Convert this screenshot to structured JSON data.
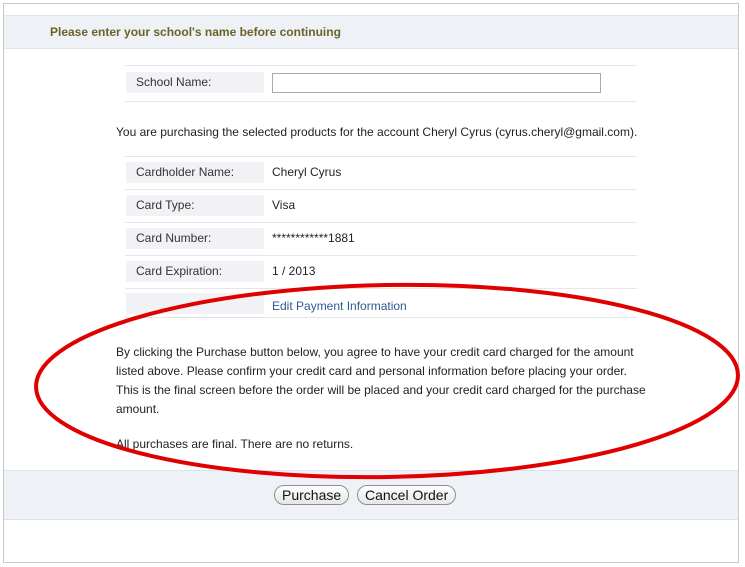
{
  "header": {
    "title": "Please enter your school's name before continuing"
  },
  "school": {
    "label": "School Name:",
    "value": ""
  },
  "account_notice": "You are purchasing the selected products for the account Cheryl Cyrus (cyrus.cheryl@gmail.com).",
  "payment": {
    "cardholder_label": "Cardholder Name:",
    "cardholder_value": "Cheryl Cyrus",
    "type_label": "Card Type:",
    "type_value": "Visa",
    "number_label": "Card Number:",
    "number_value": "************1881",
    "expiration_label": "Card Expiration:",
    "expiration_value": "1 / 2013",
    "edit_link": "Edit Payment Information"
  },
  "agreement": {
    "line1": "By clicking the Purchase button below, you agree to have your credit card charged for the amount",
    "line2": "listed above. Please confirm your credit card and personal information before placing your order.",
    "line3": "This is the final screen before the order will be placed and your credit card charged for the purchase",
    "line4": "amount.",
    "final_note": "All purchases are final. There are no returns."
  },
  "buttons": {
    "purchase": "Purchase",
    "cancel": "Cancel Order"
  },
  "colors": {
    "header_text": "#6b6327",
    "link": "#2e5a8c",
    "annotation": "#e00000",
    "panel_bg": "#eef1f6"
  }
}
